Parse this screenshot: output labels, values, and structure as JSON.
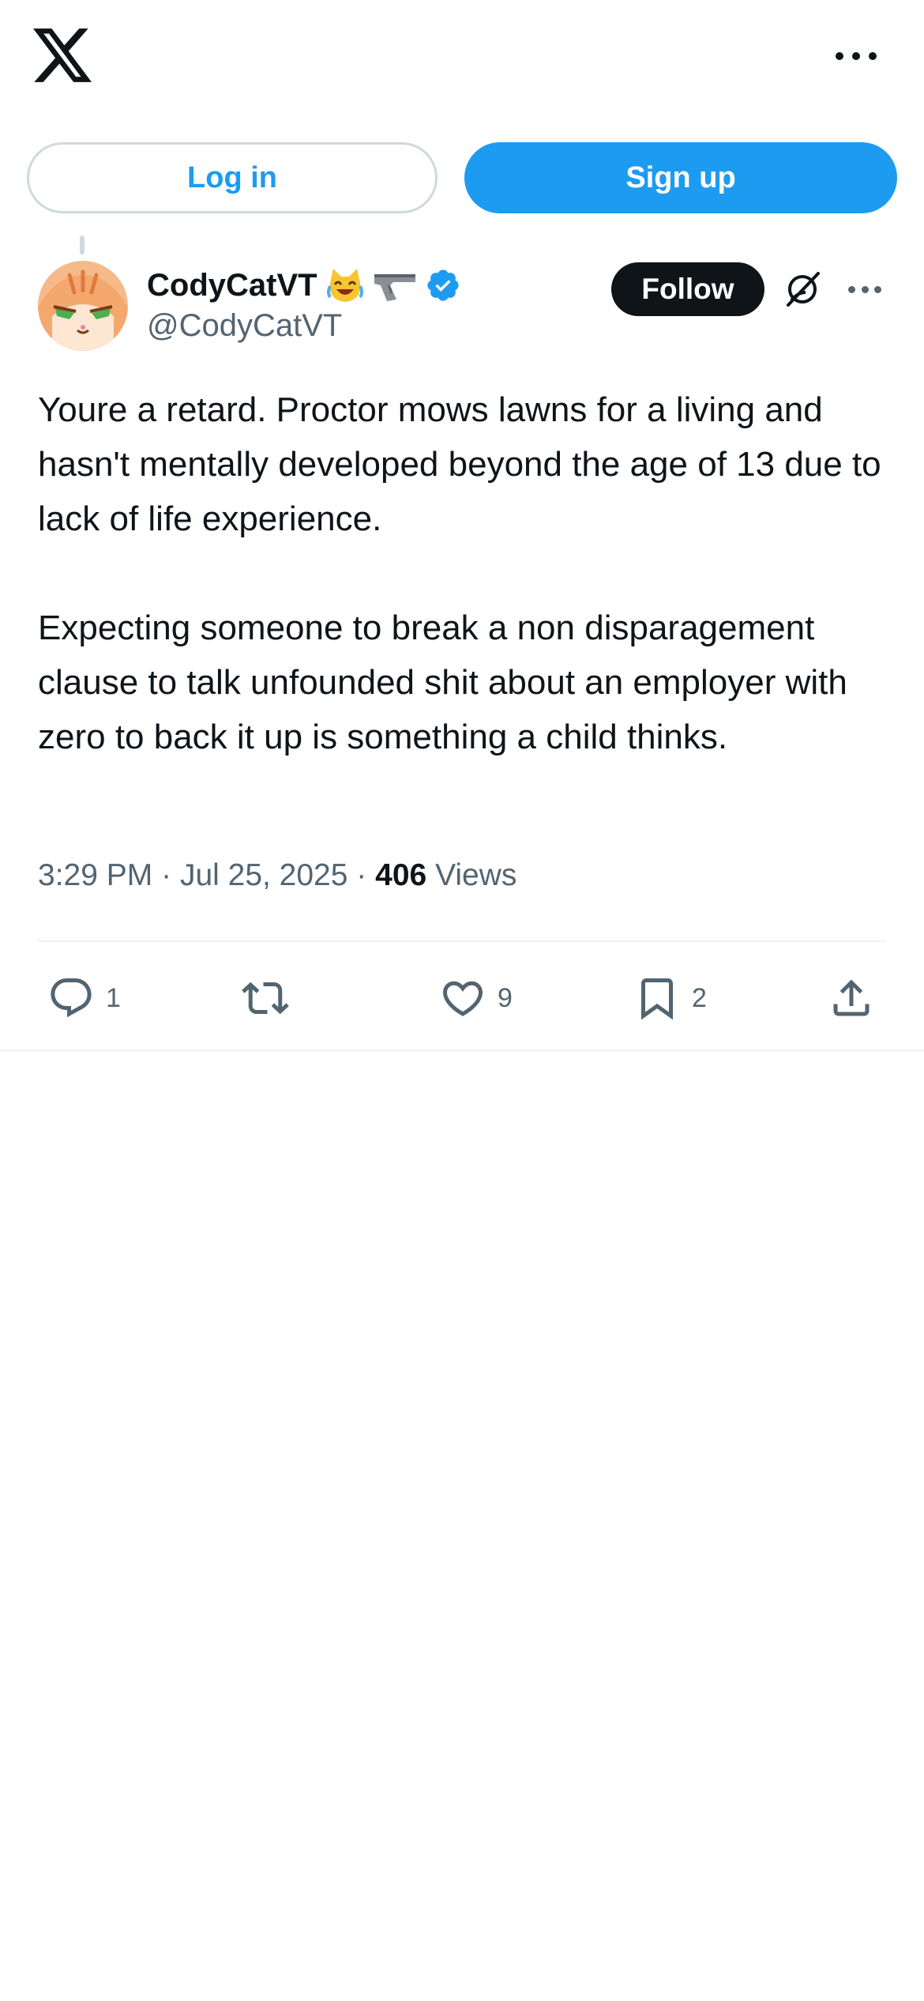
{
  "topbar": {
    "logo_icon": "x-logo-icon",
    "more_icon": "more-horizontal-icon"
  },
  "auth": {
    "login_label": "Log in",
    "signup_label": "Sign up"
  },
  "tweet": {
    "author": {
      "display_name": "CodyCatVT",
      "handle": "@CodyCatVT",
      "verified": true,
      "name_emojis": [
        "crying-laughing-cat-emoji",
        "pistol-emoji"
      ]
    },
    "follow_label": "Follow",
    "text_paragraphs": [
      "Youre a retard. Proctor mows lawns for a living and hasn't mentally developed beyond the age of 13 due to lack of life experience.",
      "Expecting someone to break a non disparagement clause to talk unfounded shit about an employer with zero to back it up is something a child thinks."
    ],
    "meta": {
      "time": "3:29 PM",
      "separator": "·",
      "date": "Jul 25, 2025",
      "views_count": "406",
      "views_label": "Views"
    },
    "actions": {
      "replies": "1",
      "reposts": "",
      "likes": "9",
      "bookmarks": "2"
    }
  },
  "colors": {
    "accent": "#1d9bf0",
    "text_primary": "#0f1419",
    "text_secondary": "#536471",
    "border": "#cfd9de",
    "divider": "#eff3f4"
  }
}
